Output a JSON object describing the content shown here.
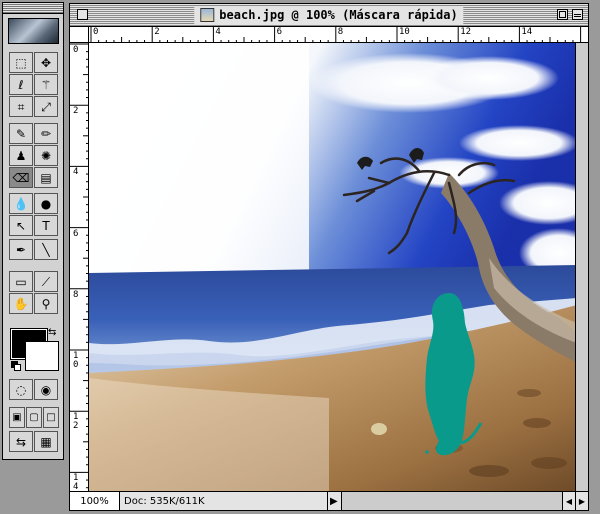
{
  "tools": [
    {
      "name": "marquee-tool",
      "glyph": "⬚"
    },
    {
      "name": "move-tool",
      "glyph": "✥"
    },
    {
      "name": "lasso-tool",
      "glyph": "ℓ"
    },
    {
      "name": "magic-wand-tool",
      "glyph": "⚚"
    },
    {
      "name": "crop-tool",
      "glyph": "⌗"
    },
    {
      "name": "eyedropper-tool",
      "glyph": "⤢"
    },
    {
      "name": "airbrush-tool",
      "glyph": "✎"
    },
    {
      "name": "pencil-tool",
      "glyph": "✏"
    },
    {
      "name": "stamp-tool",
      "glyph": "♟"
    },
    {
      "name": "history-brush-tool",
      "glyph": "✺"
    },
    {
      "name": "eraser-tool",
      "glyph": "⌫"
    },
    {
      "name": "gradient-tool",
      "glyph": "▤"
    },
    {
      "name": "blur-tool",
      "glyph": "💧"
    },
    {
      "name": "burn-tool",
      "glyph": "●"
    },
    {
      "name": "selection-arrow-tool",
      "glyph": "↖"
    },
    {
      "name": "type-tool",
      "glyph": "T"
    },
    {
      "name": "pen-tool",
      "glyph": "✒"
    },
    {
      "name": "line-tool",
      "glyph": "╲"
    },
    {
      "name": "notes-tool",
      "glyph": "▭"
    },
    {
      "name": "color-sampler-tool",
      "glyph": "⟋"
    },
    {
      "name": "hand-tool",
      "glyph": "✋"
    },
    {
      "name": "zoom-tool",
      "glyph": "⚲"
    },
    {
      "name": "standard-mode-button",
      "glyph": "◌"
    },
    {
      "name": "quick-mask-mode-button",
      "glyph": "◉"
    },
    {
      "name": "screen-mode-standard",
      "glyph": "▣"
    },
    {
      "name": "screen-mode-full-menu",
      "glyph": "▢"
    },
    {
      "name": "screen-mode-full",
      "glyph": "□"
    },
    {
      "name": "jump-to-imageready-button",
      "glyph": "⇆"
    },
    {
      "name": "jump-icon-2",
      "glyph": "▦"
    }
  ],
  "colors": {
    "foreground": "#000000",
    "background": "#ffffff"
  },
  "window": {
    "title": "beach.jpg @ 100% (Máscara rápida)"
  },
  "ruler": {
    "h_labels": [
      "0",
      "2",
      "4",
      "6",
      "8",
      "10",
      "12",
      "14"
    ],
    "v_labels": [
      "0",
      "2",
      "4",
      "6",
      "8",
      "1\n0",
      "1\n2",
      "1\n4"
    ]
  },
  "status": {
    "zoom": "100%",
    "doc_info": "Doc: 535K/611K"
  }
}
